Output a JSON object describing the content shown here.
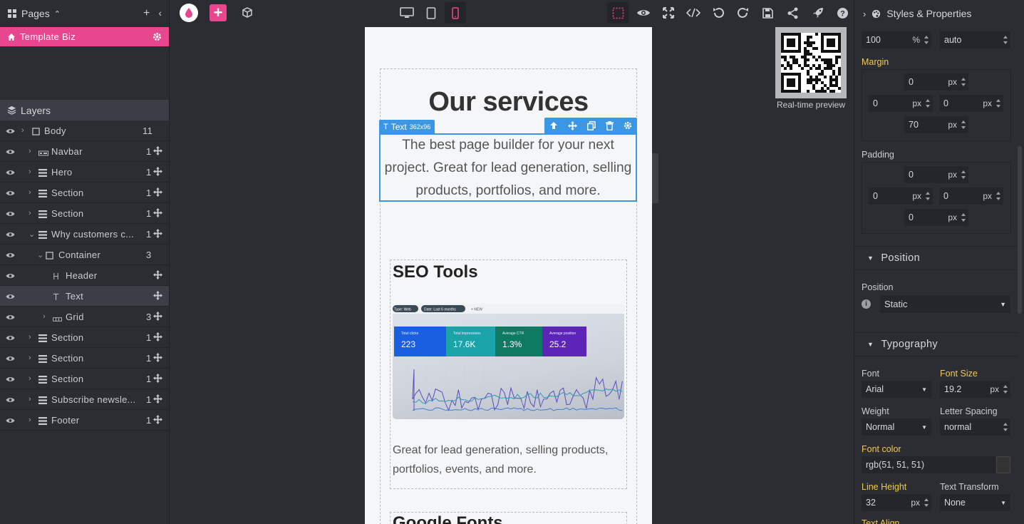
{
  "pages": {
    "title": "Pages",
    "items": [
      {
        "label": "Template Biz"
      }
    ]
  },
  "layers": {
    "title": "Layers",
    "items": [
      {
        "label": "Body",
        "count": "11",
        "depth": 0,
        "icon": "square-icon"
      },
      {
        "label": "Navbar",
        "count": "1",
        "depth": 1,
        "icon": "navbar-icon"
      },
      {
        "label": "Hero",
        "count": "1",
        "depth": 1,
        "icon": "section-icon"
      },
      {
        "label": "Section",
        "count": "1",
        "depth": 1,
        "icon": "section-icon"
      },
      {
        "label": "Section",
        "count": "1",
        "depth": 1,
        "icon": "section-icon"
      },
      {
        "label": "Why customers c...",
        "count": "1",
        "depth": 1,
        "icon": "section-icon",
        "expanded": true
      },
      {
        "label": "Container",
        "count": "3",
        "depth": 2,
        "icon": "square-icon",
        "expanded": true
      },
      {
        "label": "Header",
        "count": "",
        "depth": 3,
        "icon": "heading-icon"
      },
      {
        "label": "Text",
        "count": "",
        "depth": 3,
        "icon": "text-icon",
        "selected": true
      },
      {
        "label": "Grid",
        "count": "3",
        "depth": 3,
        "icon": "grid-icon"
      },
      {
        "label": "Section",
        "count": "1",
        "depth": 1,
        "icon": "section-icon"
      },
      {
        "label": "Section",
        "count": "1",
        "depth": 1,
        "icon": "section-icon"
      },
      {
        "label": "Section",
        "count": "1",
        "depth": 1,
        "icon": "section-icon"
      },
      {
        "label": "Subscribe newsle...",
        "count": "1",
        "depth": 1,
        "icon": "section-icon"
      },
      {
        "label": "Footer",
        "count": "1",
        "depth": 1,
        "icon": "section-icon"
      }
    ]
  },
  "canvas": {
    "section_title": "Our services",
    "selection_label": "Text",
    "selection_size": "362x96",
    "selected_text": "The best page builder for your next project. Great for lead generation, selling products, portfolios, and more.",
    "card1": {
      "title": "SEO Tools",
      "text": "Great for lead generation, selling products, portfolios, events, and more.",
      "image": {
        "chips": [
          "Type: Web",
          "Date: Last 6 months",
          "+  NEW"
        ],
        "metrics": [
          {
            "label": "Total clicks",
            "value": "223",
            "color": "#1a5fe0"
          },
          {
            "label": "Total impressions",
            "value": "17.6K",
            "color": "#1aa3a8"
          },
          {
            "label": "Average CTR",
            "value": "1.3%",
            "color": "#0f7a62"
          },
          {
            "label": "Average position",
            "value": "25.2",
            "color": "#5c25b8"
          }
        ]
      }
    },
    "card2": {
      "title": "Google Fonts"
    }
  },
  "preview": {
    "label": "Real-time preview"
  },
  "styles": {
    "title": "Styles & Properties",
    "width": {
      "value": "100",
      "unit": "%",
      "height": "auto"
    },
    "margin": {
      "label": "Margin",
      "top": "0",
      "left": "0",
      "right": "0",
      "bottom": "70",
      "unit": "px"
    },
    "padding": {
      "label": "Padding",
      "top": "0",
      "left": "0",
      "right": "0",
      "bottom": "0",
      "unit": "px"
    },
    "position_section": {
      "title": "Position",
      "label": "Position",
      "value": "Static"
    },
    "typography": {
      "title": "Typography",
      "font_label": "Font",
      "font_value": "Arial",
      "size_label": "Font Size",
      "size_value": "19.2",
      "size_unit": "px",
      "weight_label": "Weight",
      "weight_value": "Normal",
      "spacing_label": "Letter Spacing",
      "spacing_value": "normal",
      "color_label": "Font color",
      "color_value": "rgb(51, 51, 51)",
      "lh_label": "Line Height",
      "lh_value": "32",
      "lh_unit": "px",
      "transform_label": "Text Transform",
      "transform_value": "None",
      "align_label": "Text Align"
    }
  },
  "colors": {
    "accent": "#e8468e",
    "selection": "#3b97e3",
    "highlight": "#f2c94c"
  }
}
